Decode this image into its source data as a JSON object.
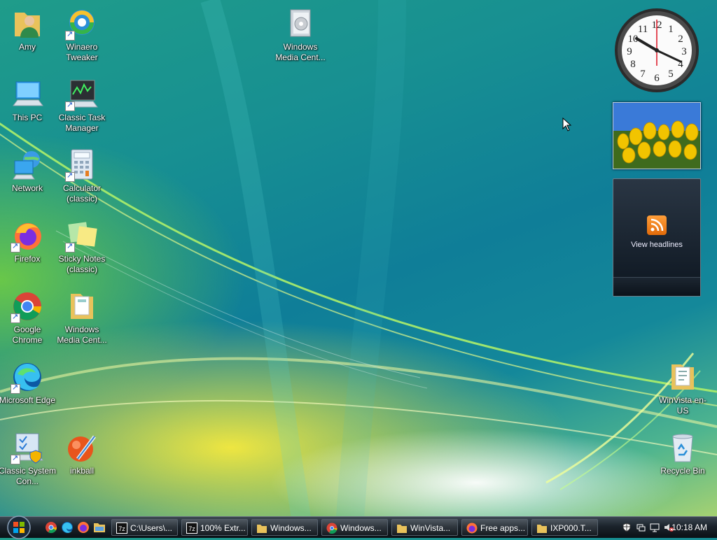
{
  "desktop_icons": [
    {
      "id": "amy",
      "label": "Amy",
      "icon": "user-folder-icon",
      "shortcut": false
    },
    {
      "id": "winaero",
      "label": "Winaero Tweaker",
      "icon": "winaero-tweaker-icon",
      "shortcut": true
    },
    {
      "id": "wmc-top",
      "label": "Windows Media Cent...",
      "icon": "media-center-icon",
      "shortcut": false
    },
    {
      "id": "thispc",
      "label": "This PC",
      "icon": "computer-icon",
      "shortcut": false
    },
    {
      "id": "taskmgr",
      "label": "Classic Task Manager",
      "icon": "task-manager-icon",
      "shortcut": true
    },
    {
      "id": "network",
      "label": "Network",
      "icon": "network-icon",
      "shortcut": false
    },
    {
      "id": "calc",
      "label": "Calculator (classic)",
      "icon": "calculator-icon",
      "shortcut": true
    },
    {
      "id": "firefox",
      "label": "Firefox",
      "icon": "firefox-icon",
      "shortcut": true
    },
    {
      "id": "sticky",
      "label": "Sticky Notes (classic)",
      "icon": "sticky-notes-icon",
      "shortcut": true
    },
    {
      "id": "chrome",
      "label": "Google Chrome",
      "icon": "chrome-icon",
      "shortcut": true
    },
    {
      "id": "wmc-folder",
      "label": "Windows Media Cent...",
      "icon": "folder-icon",
      "shortcut": false
    },
    {
      "id": "edge",
      "label": "Microsoft Edge",
      "icon": "edge-icon",
      "shortcut": true
    },
    {
      "id": "syscon",
      "label": "Classic System Con...",
      "icon": "control-panel-icon",
      "shortcut": true
    },
    {
      "id": "inkball",
      "label": "inkball",
      "icon": "inkball-icon",
      "shortcut": false
    },
    {
      "id": "winvista",
      "label": "WinVista en-US",
      "icon": "folder-icon",
      "shortcut": false
    },
    {
      "id": "recycle",
      "label": "Recycle Bin",
      "icon": "recycle-bin-icon",
      "shortcut": false
    }
  ],
  "gadgets": {
    "clock": {
      "time_display": "10:18",
      "numerals": [
        "12",
        "1",
        "2",
        "3",
        "4",
        "5",
        "6",
        "7",
        "8",
        "9",
        "10",
        "11"
      ]
    },
    "feed": {
      "label": "View headlines"
    }
  },
  "taskbar": {
    "start_label": "Start",
    "quick_launch": [
      "chrome-icon",
      "edge-icon",
      "firefox-icon",
      "explorer-icon"
    ],
    "tasks": [
      {
        "label": "C:\\Users\\...",
        "icon": "7zip-icon"
      },
      {
        "label": "100% Extr...",
        "icon": "7zip-icon"
      },
      {
        "label": "Windows...",
        "icon": "folder-icon"
      },
      {
        "label": "Windows...",
        "icon": "chrome-icon"
      },
      {
        "label": "WinVista...",
        "icon": "folder-icon"
      },
      {
        "label": "Free apps...",
        "icon": "firefox-icon"
      },
      {
        "label": "IXP000.T...",
        "icon": "folder-icon"
      }
    ],
    "tray_icons": [
      "security-icon",
      "network-status-icon",
      "display-icon",
      "volume-muted-icon"
    ],
    "clock": "10:18 AM"
  },
  "colors": {
    "accent": "#1c8fa0",
    "taskbar": "#1b232b"
  }
}
